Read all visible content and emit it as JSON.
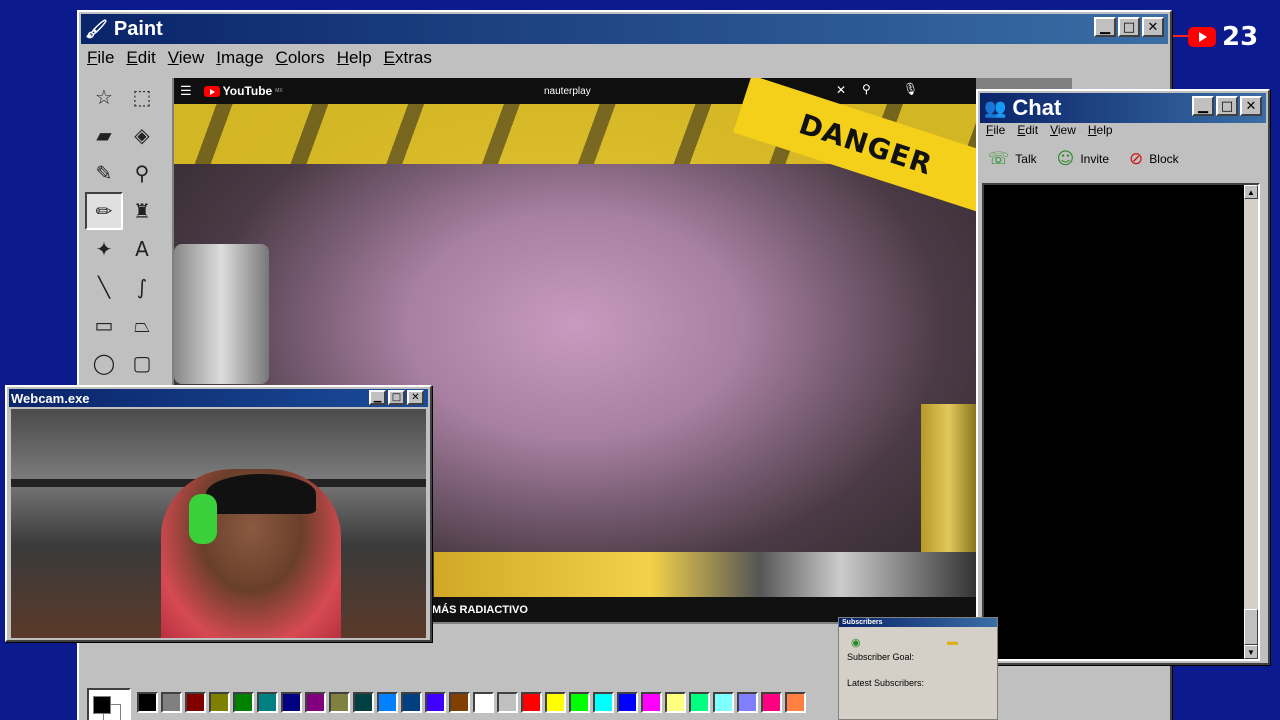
{
  "paint": {
    "title": "Paint",
    "menu": [
      "File",
      "Edit",
      "View",
      "Image",
      "Colors",
      "Help",
      "Extras"
    ],
    "tools": [
      {
        "name": "free-select-tool",
        "glyph": "☆"
      },
      {
        "name": "rect-select-tool",
        "glyph": "⬚"
      },
      {
        "name": "eraser-tool",
        "glyph": "▰"
      },
      {
        "name": "fill-tool",
        "glyph": "◈"
      },
      {
        "name": "color-picker-tool",
        "glyph": "✎"
      },
      {
        "name": "magnifier-tool",
        "glyph": "⚲"
      },
      {
        "name": "pencil-tool",
        "glyph": "✏"
      },
      {
        "name": "brush-tool",
        "glyph": "♜"
      },
      {
        "name": "airbrush-tool",
        "glyph": "✦"
      },
      {
        "name": "text-tool",
        "glyph": "A"
      },
      {
        "name": "line-tool",
        "glyph": "╲"
      },
      {
        "name": "curve-tool",
        "glyph": "∫"
      },
      {
        "name": "rectangle-tool",
        "glyph": "▭"
      },
      {
        "name": "polygon-tool",
        "glyph": "⏢"
      },
      {
        "name": "ellipse-tool",
        "glyph": "◯"
      },
      {
        "name": "rounded-rect-tool",
        "glyph": "▢"
      }
    ],
    "active_tool_index": 6,
    "palette": [
      "#000000",
      "#808080",
      "#800000",
      "#808000",
      "#008000",
      "#008080",
      "#000080",
      "#800080",
      "#808040",
      "#004040",
      "#0080ff",
      "#004080",
      "#4000ff",
      "#804000",
      "#ffffff",
      "#c0c0c0",
      "#ff0000",
      "#ffff00",
      "#00ff00",
      "#00ffff",
      "#0000ff",
      "#ff00ff",
      "#ffff80",
      "#00ff80",
      "#80ffff",
      "#8080ff",
      "#ff0080",
      "#ff8040"
    ]
  },
  "youtube": {
    "logo": "YouTube",
    "country": "MX",
    "search_value": "nauterplay",
    "caption": "MÁS RADIACTIVO",
    "tape_text": "DANGER"
  },
  "webcam": {
    "title": "Webcam.exe"
  },
  "chat": {
    "title": "Chat",
    "menu": [
      "File",
      "Edit",
      "View",
      "Help"
    ],
    "tools": [
      {
        "label": "Talk",
        "icon": "talk-icon",
        "glyph": "☏"
      },
      {
        "label": "Invite",
        "icon": "invite-icon",
        "glyph": "☺"
      },
      {
        "label": "Block",
        "icon": "block-icon",
        "glyph": "⊘"
      }
    ]
  },
  "subscribers": {
    "title": "Subscribers",
    "goal_label": "Subscriber Goal:",
    "latest_label": "Latest Subscribers:"
  },
  "badge": {
    "count": "23"
  }
}
